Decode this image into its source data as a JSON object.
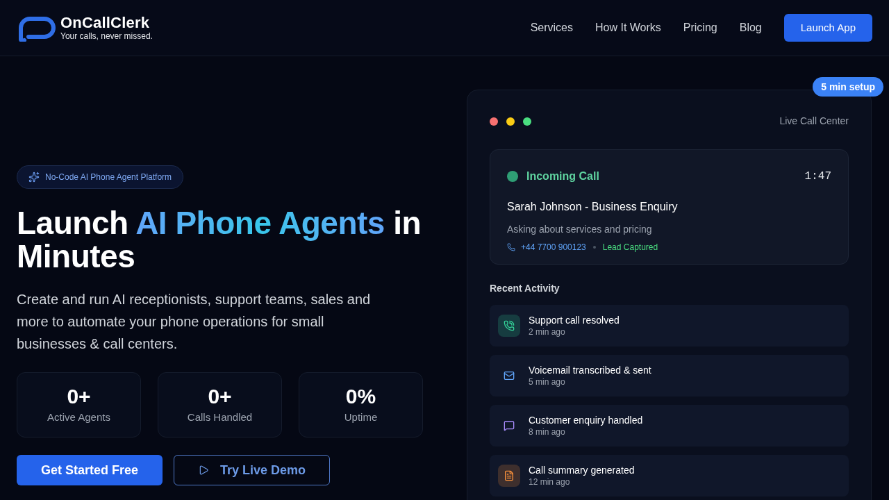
{
  "header": {
    "logo": {
      "name": "OnCallClerk",
      "tagline": "Your calls, never missed."
    },
    "nav": [
      {
        "label": "Services"
      },
      {
        "label": "How It Works"
      },
      {
        "label": "Pricing"
      },
      {
        "label": "Blog"
      }
    ],
    "cta": "Launch App"
  },
  "hero": {
    "badge": "No-Code AI Phone Agent Platform",
    "title": {
      "lead": "Launch",
      "highlight": "AI Phone Agents",
      "tail": "in Minutes"
    },
    "description": "Create and run AI receptionists, support teams, sales and more to automate your phone operations for small businesses & call centers.",
    "stats": [
      {
        "value": "0+",
        "label": "Active Agents"
      },
      {
        "value": "0+",
        "label": "Calls Handled"
      },
      {
        "value": "0%",
        "label": "Uptime"
      }
    ],
    "buttons": [
      {
        "label": "Get Started Free",
        "kind": "primary"
      },
      {
        "label": "Try Live Demo",
        "kind": "outline"
      }
    ]
  },
  "live_panel": {
    "badge": "5 min setup",
    "title": "Live Call Center",
    "window_dots": [
      {
        "color": "#f87171"
      },
      {
        "color": "#facc15"
      },
      {
        "color": "#4ade80"
      }
    ],
    "incoming_call": {
      "status": "Incoming Call",
      "timer": "1:47",
      "caller": "Sarah Johnson - Business Enquiry",
      "summary": "Asking about services and pricing",
      "phone": "+44 7700 900123",
      "tag": "Lead Captured"
    },
    "recent_activity": {
      "title": "Recent Activity",
      "items": [
        {
          "title": "Support call resolved",
          "time": "2 min ago",
          "kind": "call",
          "color": "#34d399",
          "highlighted": true
        },
        {
          "title": "Voicemail transcribed & sent",
          "time": "5 min ago",
          "kind": "mail",
          "color": "#60a5fa",
          "highlighted": false
        },
        {
          "title": "Customer enquiry handled",
          "time": "8 min ago",
          "kind": "message",
          "color": "#a78bfa",
          "highlighted": false
        },
        {
          "title": "Call summary generated",
          "time": "12 min ago",
          "kind": "document",
          "color": "#fb923c",
          "highlighted": true
        }
      ]
    }
  }
}
